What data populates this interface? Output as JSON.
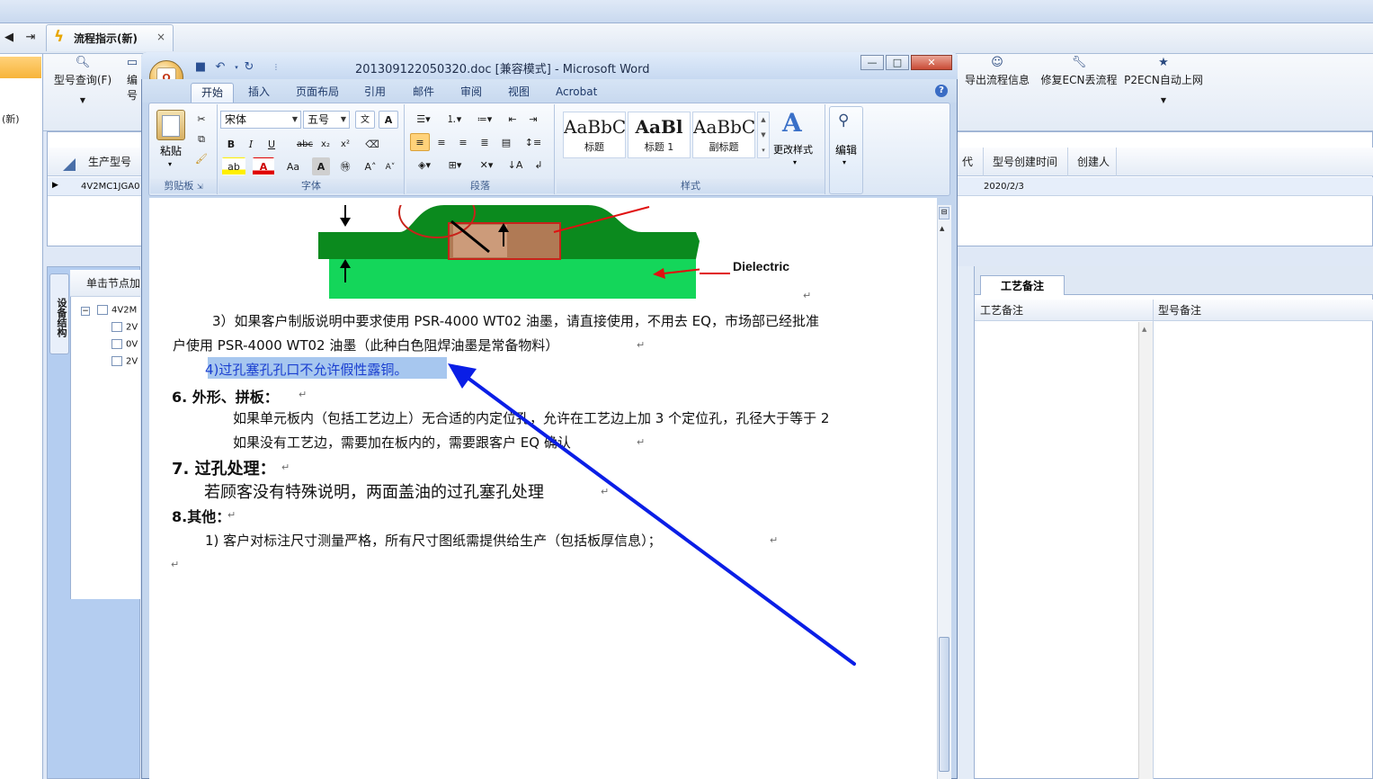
{
  "bg_app": {
    "tab_title": "流程指示(新)",
    "tab_close": "×",
    "left_text": "(新)",
    "ribbon_left": [
      {
        "label": "型号查询(F)",
        "icon": "search-icon"
      },
      {
        "label": "编号",
        "icon": "doc-icon"
      }
    ],
    "ribbon_right": [
      {
        "label": "导出流程信息",
        "icon": "smile-icon"
      },
      {
        "label": "修复ECN丢流程",
        "icon": "wrench-icon"
      },
      {
        "label": "P2ECN自动上网",
        "icon": "star-icon"
      }
    ],
    "grid": {
      "headers": [
        "生产型号",
        "代码",
        "型号创建时间",
        "创建人"
      ],
      "row": {
        "model": "4V2MC1JGA0",
        "created": "2020/2/3"
      }
    },
    "lower_left": {
      "vtab": "设备结构",
      "tree_header": "单击节点加",
      "tree_items": [
        "4V2M",
        "2V",
        "0V",
        "2V"
      ]
    },
    "right_panel": {
      "tab": "工艺备注",
      "columns": [
        "工艺备注",
        "型号备注"
      ]
    }
  },
  "word": {
    "title": "201309122050320.doc [兼容模式] - Microsoft Word",
    "tabs": [
      "开始",
      "插入",
      "页面布局",
      "引用",
      "邮件",
      "审阅",
      "视图",
      "Acrobat"
    ],
    "active_tab": "开始",
    "ribbon": {
      "clipboard": {
        "paste": "粘贴",
        "group": "剪贴板"
      },
      "font": {
        "name": "宋体",
        "size": "五号",
        "group": "字体"
      },
      "paragraph": {
        "group": "段落"
      },
      "styles": {
        "items": [
          {
            "preview": "AaBbC",
            "name": "标题"
          },
          {
            "preview": "AaBl",
            "name": "标题 1"
          },
          {
            "preview": "AaBbC",
            "name": "副标题"
          }
        ],
        "change": "更改样式",
        "group": "样式"
      },
      "editing": {
        "label": "编辑"
      }
    },
    "document": {
      "diagram_label": "Dielectric",
      "lines": [
        "3）如果客户制版说明中要求使用 PSR-4000  WT02  油墨，请直接使用，不用去 EQ，市场部已经批准",
        "户使用 PSR-4000 WT02  油墨（此种白色阻焊油墨是常备物料）",
        "4)过孔塞孔孔口不允许假性露铜。",
        "6.    外形、拼板：",
        "如果单元板内（包括工艺边上）无合适的内定位孔，允许在工艺边上加 3 个定位孔，孔径大于等于 2",
        "如果没有工艺边，需要加在板内的，需要跟客户 EQ 确认",
        "7. 过孔处理：",
        "若顾客没有特殊说明，两面盖油的过孔塞孔处理",
        "8.其他：",
        "1)    客户对标注尺寸测量严格，所有尺寸图纸需提供给生产（包括板厚信息）；"
      ]
    }
  },
  "colors": {
    "selection": "#a7c7ef",
    "annotation_arrow": "#0a1ee6",
    "diagram_green_dark": "#0b8a1e",
    "diagram_green_light": "#14d65a",
    "diagram_copper": "#b07a55"
  }
}
